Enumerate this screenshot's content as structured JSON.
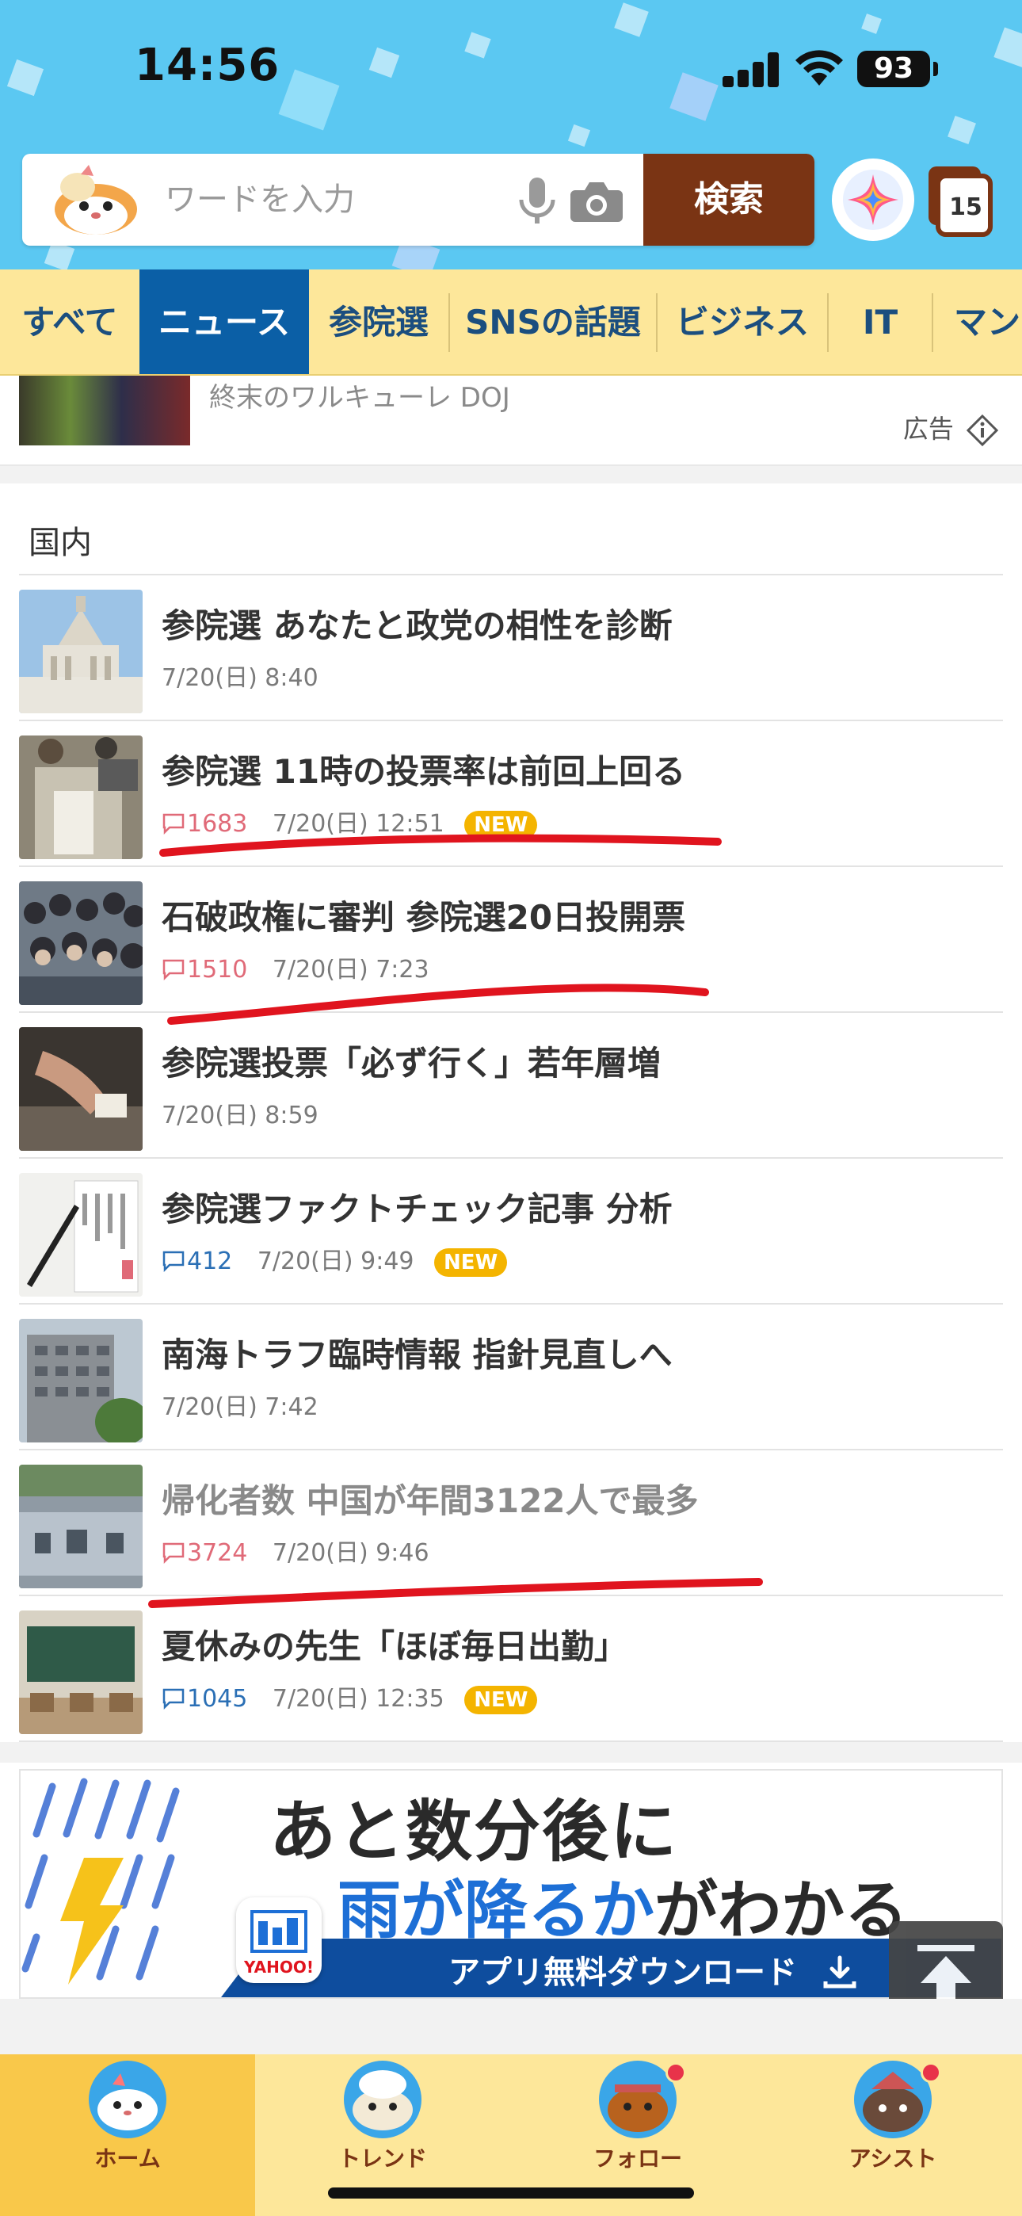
{
  "status_bar": {
    "time": "14:56",
    "battery": "93"
  },
  "search": {
    "placeholder": "ワードを入力",
    "button_label": "検索",
    "tab_count": "15"
  },
  "categories": [
    {
      "label": "すべて"
    },
    {
      "label": "ニュース",
      "active": true
    },
    {
      "label": "参院選"
    },
    {
      "label": "SNSの話題"
    },
    {
      "label": "ビジネス"
    },
    {
      "label": "IT"
    },
    {
      "label": "マン"
    }
  ],
  "ad": {
    "text": "終末のワルキューレ DOJ",
    "label": "広告"
  },
  "section": {
    "title": "国内"
  },
  "articles": [
    {
      "title": "参院選 あなたと政党の相性を診断",
      "date": "7/20(日) 8:40",
      "comments": "",
      "new": false,
      "read": false
    },
    {
      "title": "参院選 11時の投票率は前回上回る",
      "date": "7/20(日) 12:51",
      "comments": "1683",
      "new": true,
      "new_label": "NEW",
      "read": false,
      "hot": true
    },
    {
      "title": "石破政権に審判 参院選20日投開票",
      "date": "7/20(日) 7:23",
      "comments": "1510",
      "new": false,
      "read": false,
      "hot": true
    },
    {
      "title": "参院選投票「必ず行く」若年層増",
      "date": "7/20(日) 8:59",
      "comments": "",
      "new": false,
      "read": false
    },
    {
      "title": "参院選ファクトチェック記事 分析",
      "date": "7/20(日) 9:49",
      "comments": "412",
      "new": true,
      "new_label": "NEW",
      "read": false,
      "hot": false
    },
    {
      "title": "南海トラフ臨時情報 指針見直しへ",
      "date": "7/20(日) 7:42",
      "comments": "",
      "new": false,
      "read": false
    },
    {
      "title": "帰化者数 中国が年間3122人で最多",
      "date": "7/20(日) 9:46",
      "comments": "3724",
      "new": false,
      "read": true,
      "hot": true
    },
    {
      "title": "夏休みの先生「ほぼ毎日出勤」",
      "date": "7/20(日) 12:35",
      "comments": "1045",
      "new": true,
      "new_label": "NEW",
      "read": false,
      "hot": false
    }
  ],
  "banner": {
    "line1": "あと数分後に",
    "line2_blue": "雨が降るか",
    "line2_rest": "がわかる",
    "download": "アプリ無料ダウンロード",
    "app_brand": "YAHOO!"
  },
  "bottom_nav": [
    {
      "label": "ホーム",
      "active": true,
      "badge": false
    },
    {
      "label": "トレンド",
      "active": false,
      "badge": false
    },
    {
      "label": "フォロー",
      "active": false,
      "badge": true
    },
    {
      "label": "アシスト",
      "active": false,
      "badge": true
    }
  ],
  "colors": {
    "header_bg": "#5bc8f2",
    "tab_bar_bg": "#fde79a",
    "active_tab": "#0b5fa6",
    "search_button": "#7a3414",
    "new_badge": "#f4b400",
    "hot_comment": "#e06a78",
    "annotation_red": "#e0141e"
  }
}
